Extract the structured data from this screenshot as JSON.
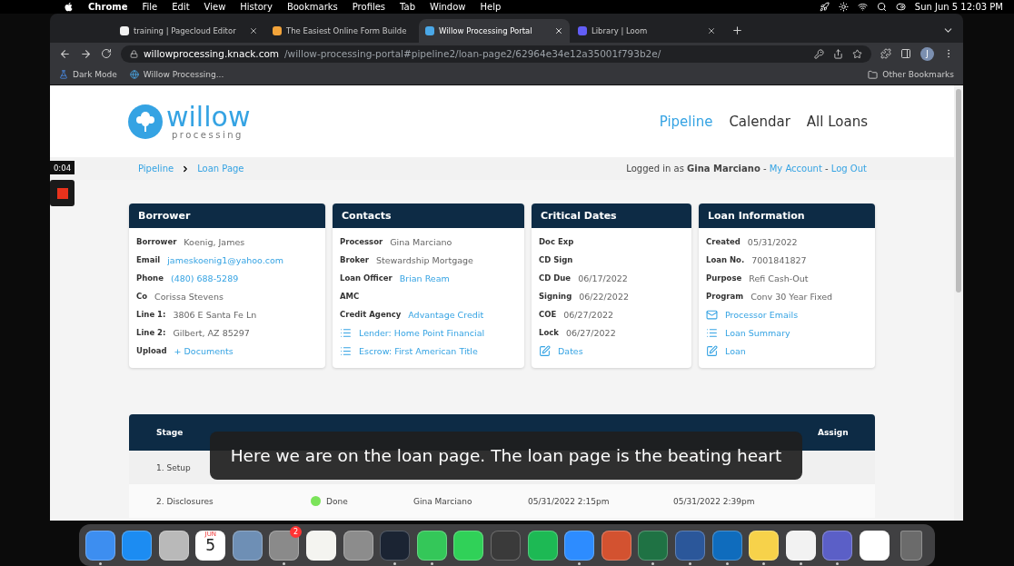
{
  "menubar": {
    "app": "Chrome",
    "items": [
      "File",
      "Edit",
      "View",
      "History",
      "Bookmarks",
      "Profiles",
      "Tab",
      "Window",
      "Help"
    ],
    "clock": "Sun Jun 5  12:03 PM"
  },
  "browser": {
    "tabs": [
      {
        "title": "training | Pagecloud Editor",
        "selected": false,
        "color": "#f1f1f1"
      },
      {
        "title": "The Easiest Online Form Builde",
        "selected": false,
        "color": "#f2a33a"
      },
      {
        "title": "Willow Processing Portal",
        "selected": true,
        "color": "#4aa8e8"
      },
      {
        "title": "Library | Loom",
        "selected": false,
        "color": "#625df5"
      }
    ],
    "url_host": "willowprocessing.knack.com",
    "url_path": "/willow-processing-portal#pipeline2/loan-page2/62964e34e12a35001f793b2e/",
    "profile": "J",
    "bookmarks": [
      "Dark Mode",
      "Willow Processing..."
    ],
    "other_bookmarks": "Other Bookmarks"
  },
  "recorder": {
    "time": "0:04"
  },
  "page": {
    "logo": {
      "word": "willow",
      "sub": "processing"
    },
    "nav": [
      {
        "label": "Pipeline",
        "selected": true
      },
      {
        "label": "Calendar",
        "selected": false
      },
      {
        "label": "All Loans",
        "selected": false
      }
    ],
    "breadcrumb": [
      "Pipeline",
      "Loan Page"
    ],
    "login": {
      "text": "Logged in as **Gina Marciano** - ",
      "links": [
        "My Account",
        "Log Out"
      ],
      "separator": "-"
    },
    "cards": [
      {
        "title": "Borrower",
        "fields": [
          {
            "kind": "pair",
            "label": "Borrower",
            "value": "Koenig, James"
          },
          {
            "kind": "link",
            "label": "Email",
            "value": "jameskoenig1@yahoo.com"
          },
          {
            "kind": "link",
            "label": "Phone",
            "value": "(480) 688-5289"
          },
          {
            "kind": "pair",
            "label": "Co",
            "value": "Corissa Stevens"
          },
          {
            "kind": "pair",
            "label": "Line 1:",
            "value": "3806 E Santa Fe Ln"
          },
          {
            "kind": "pair",
            "label": "Line 2:",
            "value": "Gilbert, AZ 85297"
          },
          {
            "kind": "link",
            "label": "Upload",
            "value": "+ Documents"
          }
        ]
      },
      {
        "title": "Contacts",
        "fields": [
          {
            "kind": "pair",
            "label": "Processor",
            "value": "Gina Marciano"
          },
          {
            "kind": "pair",
            "label": "Broker",
            "value": "Stewardship Mortgage"
          },
          {
            "kind": "link",
            "label": "Loan Officer",
            "value": "Brian Ream"
          },
          {
            "kind": "pair",
            "label": "AMC"
          },
          {
            "kind": "link",
            "label": "Credit Agency",
            "value": "Advantage Credit"
          },
          {
            "kind": "list",
            "value": "Lender: Home Point Financial"
          },
          {
            "kind": "list",
            "value": "Escrow: First American Title"
          }
        ]
      },
      {
        "title": "Critical Dates",
        "fields": [
          {
            "kind": "pair",
            "label": "Doc Exp"
          },
          {
            "kind": "pair",
            "label": "CD Sign"
          },
          {
            "kind": "pair",
            "label": "CD Due",
            "value": "06/17/2022"
          },
          {
            "kind": "pair",
            "label": "Signing",
            "value": "06/22/2022"
          },
          {
            "kind": "pair",
            "label": "COE",
            "value": "06/27/2022"
          },
          {
            "kind": "pair",
            "label": "Lock",
            "value": "06/27/2022"
          },
          {
            "kind": "edit",
            "value": "Dates"
          }
        ]
      },
      {
        "title": "Loan Information",
        "fields": [
          {
            "kind": "pair",
            "label": "Created",
            "value": "05/31/2022"
          },
          {
            "kind": "pair",
            "label": "Loan No.",
            "value": "7001841827"
          },
          {
            "kind": "pair",
            "label": "Purpose",
            "value": "Refi Cash-Out"
          },
          {
            "kind": "pair",
            "label": "Program",
            "value": "Conv 30 Year Fixed"
          },
          {
            "kind": "mail",
            "value": "Processor Emails"
          },
          {
            "kind": "list",
            "value": "Loan Summary"
          },
          {
            "kind": "edit",
            "value": "Loan"
          }
        ]
      }
    ],
    "table": {
      "columns": {
        "stage": "Stage",
        "assign": "Assign"
      },
      "rows": [
        {
          "stage": "1. Setup"
        },
        {
          "stage": "2. Disclosures",
          "status": "Done",
          "color": "#7be35a",
          "member": "Gina Marciano",
          "started": "05/31/2022 2:15pm",
          "done": "05/31/2022 2:39pm"
        }
      ]
    }
  },
  "caption": "Here we are on the loan page. The loan page is the beating heart",
  "dock": {
    "calendar_month": "JUN",
    "calendar_day": "5",
    "badge": "2",
    "apps": [
      {
        "color": "#3d8ef0",
        "running": true
      },
      {
        "color": "#1c8cf2",
        "running": false
      },
      {
        "color": "#b9b9b9",
        "running": false
      },
      {
        "kind": "calendar",
        "running": false
      },
      {
        "color": "#6e8fb5",
        "running": false
      },
      {
        "kind": "settings",
        "color": "#8a8a8a",
        "running": true
      },
      {
        "color": "#f4f4f0",
        "running": false
      },
      {
        "color": "#8c8c8c",
        "running": false
      },
      {
        "color": "#1b2433",
        "running": true
      },
      {
        "color": "#34c759",
        "running": true
      },
      {
        "color": "#30d158",
        "running": false
      },
      {
        "color": "#3a3a3a",
        "running": false
      },
      {
        "color": "#1db954",
        "running": false
      },
      {
        "color": "#2d8cff",
        "running": true
      },
      {
        "color": "#d35230",
        "running": false
      },
      {
        "color": "#1f7244",
        "running": true
      },
      {
        "color": "#2b579a",
        "running": true
      },
      {
        "color": "#0f6cbd",
        "running": true
      },
      {
        "color": "#f7d24a",
        "running": true
      },
      {
        "color": "#f2f2f2",
        "running": true
      },
      {
        "color": "#5b5fc7",
        "running": true
      },
      {
        "color": "#ffffff",
        "running": false
      },
      {
        "kind": "trash",
        "color": "#6b6b6b",
        "running": false
      }
    ]
  }
}
